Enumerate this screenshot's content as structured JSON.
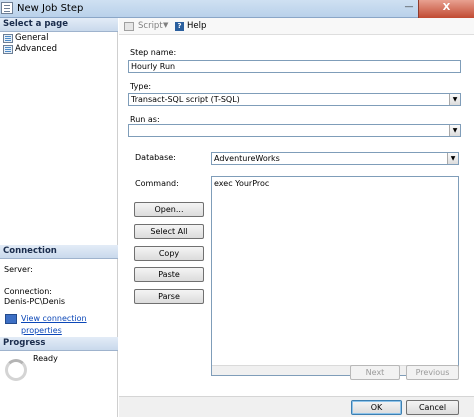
{
  "window": {
    "title": "New Job Step",
    "close_symbol": "X",
    "minimize_symbol": "—"
  },
  "sidebar": {
    "select_page_header": "Select a page",
    "pages": [
      {
        "label": "General",
        "icon": "page-icon"
      },
      {
        "label": "Advanced",
        "icon": "page-icon"
      }
    ],
    "connection_header": "Connection",
    "server_label": "Server:",
    "connection_label": "Connection:",
    "connection_value": "Denis-PC\\Denis",
    "connection_link": "View connection properties",
    "progress_header": "Progress",
    "progress_status": "Ready"
  },
  "toolbar": {
    "script_label": "Script",
    "help_label": "Help",
    "script_icon": "script-icon",
    "help_icon": "help-icon"
  },
  "form": {
    "step_name_label": "Step name:",
    "step_name_value": "Hourly Run",
    "type_label": "Type:",
    "type_value": "Transact-SQL script (T-SQL)",
    "run_as_label": "Run as:",
    "run_as_value": "",
    "database_label": "Database:",
    "database_value": "AdventureWorks",
    "command_label": "Command:",
    "command_value": "exec YourProc",
    "buttons": {
      "open": "Open...",
      "select_all": "Select All",
      "copy": "Copy",
      "paste": "Paste",
      "parse": "Parse"
    },
    "next_label": "Next",
    "previous_label": "Previous"
  },
  "footer": {
    "ok_label": "OK",
    "cancel_label": "Cancel"
  },
  "colors": {
    "title_bar": "#b9d1ea",
    "close_button": "#c14a32",
    "link": "#0b47b8",
    "section_header": "#c9d9ec"
  }
}
